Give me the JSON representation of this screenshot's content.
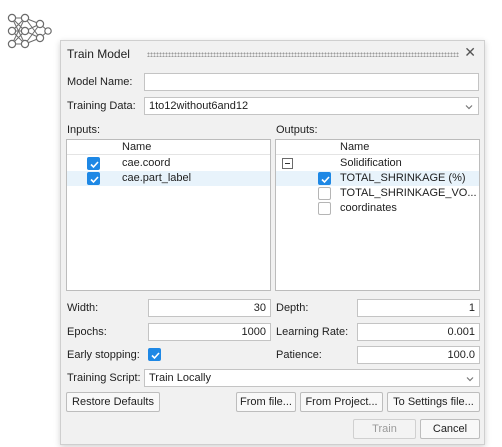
{
  "dialog": {
    "title": "Train Model",
    "close_glyph": "✕",
    "model_name": {
      "label": "Model Name:",
      "value": ""
    },
    "training_data": {
      "label": "Training Data:",
      "value": "1to12without6and12"
    },
    "inputs": {
      "label": "Inputs:",
      "column_header": "Name",
      "items": [
        {
          "name": "cae.coord",
          "checked": true
        },
        {
          "name": "cae.part_label",
          "checked": true
        }
      ]
    },
    "outputs": {
      "label": "Outputs:",
      "column_header": "Name",
      "group": {
        "name": "Solidification",
        "expanded": true
      },
      "items": [
        {
          "name": "TOTAL_SHRINKAGE (%)",
          "checked": true
        },
        {
          "name": "TOTAL_SHRINKAGE_VO...",
          "checked": false
        },
        {
          "name": "coordinates",
          "checked": false
        }
      ]
    },
    "width": {
      "label": "Width:",
      "value": "30"
    },
    "depth": {
      "label": "Depth:",
      "value": "1"
    },
    "epochs": {
      "label": "Epochs:",
      "value": "1000"
    },
    "learning_rate": {
      "label": "Learning Rate:",
      "value": "0.001"
    },
    "early_stopping": {
      "label": "Early stopping:",
      "checked": true
    },
    "patience": {
      "label": "Patience:",
      "value": "100.0"
    },
    "training_script": {
      "label": "Training Script:",
      "value": "Train Locally"
    },
    "buttons": {
      "restore_defaults": "Restore Defaults",
      "from_file": "From file...",
      "from_project": "From Project...",
      "to_settings_file": "To Settings file...",
      "train": "Train",
      "cancel": "Cancel"
    }
  },
  "icons": {
    "app_icon": "neural-network-icon",
    "checkbox": "checkmark-icon",
    "dropdown": "chevron-down-icon",
    "collapse": "minus-icon"
  },
  "colors": {
    "accent": "#1e88e5",
    "dialog_background": "#f1f1f1",
    "selected_row": "#e8f3fb"
  }
}
